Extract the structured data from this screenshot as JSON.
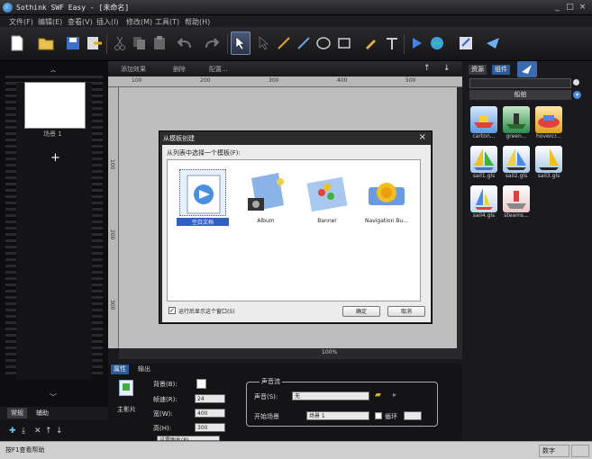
{
  "window": {
    "title": "Sothink SWF Easy - [未命名]",
    "min": "_",
    "max": "□",
    "close": "×"
  },
  "menu": [
    "文件(F)",
    "编辑(E)",
    "查看(V)",
    "插入(I)",
    "修改(M)",
    "工具(T)",
    "帮助(H)"
  ],
  "center_tabs": [
    "添加效果",
    "删除",
    "配置..."
  ],
  "left": {
    "scene_label": "场景 1",
    "add": "+",
    "tabs": [
      "常规",
      "辅助"
    ]
  },
  "ruler_h": [
    "100",
    "200",
    "300",
    "400",
    "500"
  ],
  "ruler_v": [
    "100",
    "200",
    "300"
  ],
  "zoom": "100%",
  "dialog": {
    "title": "从模板创建",
    "close": "×",
    "prompt": "从列表中选择一个模板(F):",
    "templates": [
      {
        "label": "空白文档"
      },
      {
        "label": "Album"
      },
      {
        "label": "Banner"
      },
      {
        "label": "Navigation Bu..."
      }
    ],
    "checkbox_checked": "✓",
    "checkbox_label": "运行后显示这个窗口(S)",
    "ok": "确定",
    "cancel": "取消"
  },
  "right": {
    "tabs": [
      "资源",
      "组件"
    ],
    "category": "船舶",
    "assets": [
      "carton...",
      "green...",
      "hovercr...",
      "sail1.gls",
      "sail2.gls",
      "sail3.gls",
      "sail4.gls",
      "steams..."
    ]
  },
  "props": {
    "tabs": [
      "属性",
      "输出"
    ],
    "section": "主影片",
    "bg_label": "背景(B):",
    "fps_label": "帧速(R):",
    "fps": "24",
    "width_label": "宽(W):",
    "width": "400",
    "height_label": "高(H):",
    "height": "300",
    "sound_group": "声音流",
    "sound_label": "声音(S):",
    "sound": "无",
    "start_label": "开始场景",
    "start": "场景 1",
    "loop_label": "循环",
    "more": "设置图片(P)..."
  },
  "status": {
    "help": "按F1查看帮助",
    "mode": "数字"
  }
}
